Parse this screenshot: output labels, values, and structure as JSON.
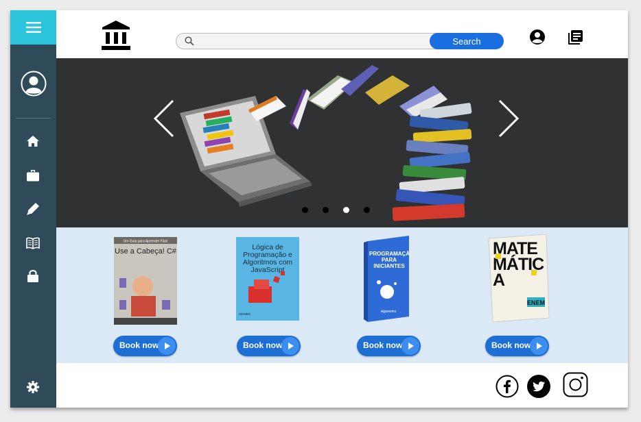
{
  "header": {
    "logo_icon": "bank-icon",
    "search": {
      "placeholder": "",
      "button_label": "Search"
    },
    "icons": [
      "user-circle-icon",
      "library-books-icon"
    ]
  },
  "sidebar": {
    "menu_icon": "hamburger-icon",
    "avatar_icon": "user-avatar-icon",
    "items": [
      {
        "icon": "home-icon"
      },
      {
        "icon": "briefcase-icon"
      },
      {
        "icon": "pencil-icon"
      },
      {
        "icon": "open-book-icon"
      },
      {
        "icon": "lock-icon"
      }
    ],
    "settings_icon": "gear-icon"
  },
  "hero": {
    "image": "laptop-flying-books-illustration",
    "slides": 4,
    "active_slide": 3
  },
  "books": [
    {
      "cover_title": "Use a Cabeça! C#",
      "cover_tagline": "Um Guia para Aprender Fácil",
      "button_label": "Book now",
      "cover_color": "#c9c6bf"
    },
    {
      "cover_title": "Lógica de Programação e Algoritmos com JavaScript",
      "cover_publisher": "novatec",
      "button_label": "Book now",
      "cover_color": "#59b6e4"
    },
    {
      "cover_title": "PROGRAMAÇÃO PARA INICIANTES",
      "cover_publisher": "algaworks",
      "button_label": "Book now",
      "cover_color": "#2f6bd6"
    },
    {
      "cover_title": "MATEMÁTICA",
      "cover_subtitle": "ENEM",
      "button_label": "Book now",
      "cover_color": "#f4f1e6"
    }
  ],
  "footer": {
    "social": [
      "facebook-icon",
      "twitter-icon",
      "instagram-icon"
    ]
  },
  "colors": {
    "sidebar": "#2f4a59",
    "menu_accent": "#2bc4dc",
    "hero_bg": "#2f3133",
    "books_bg": "#dbe9f6",
    "button_blue": "#1a6fe0"
  }
}
